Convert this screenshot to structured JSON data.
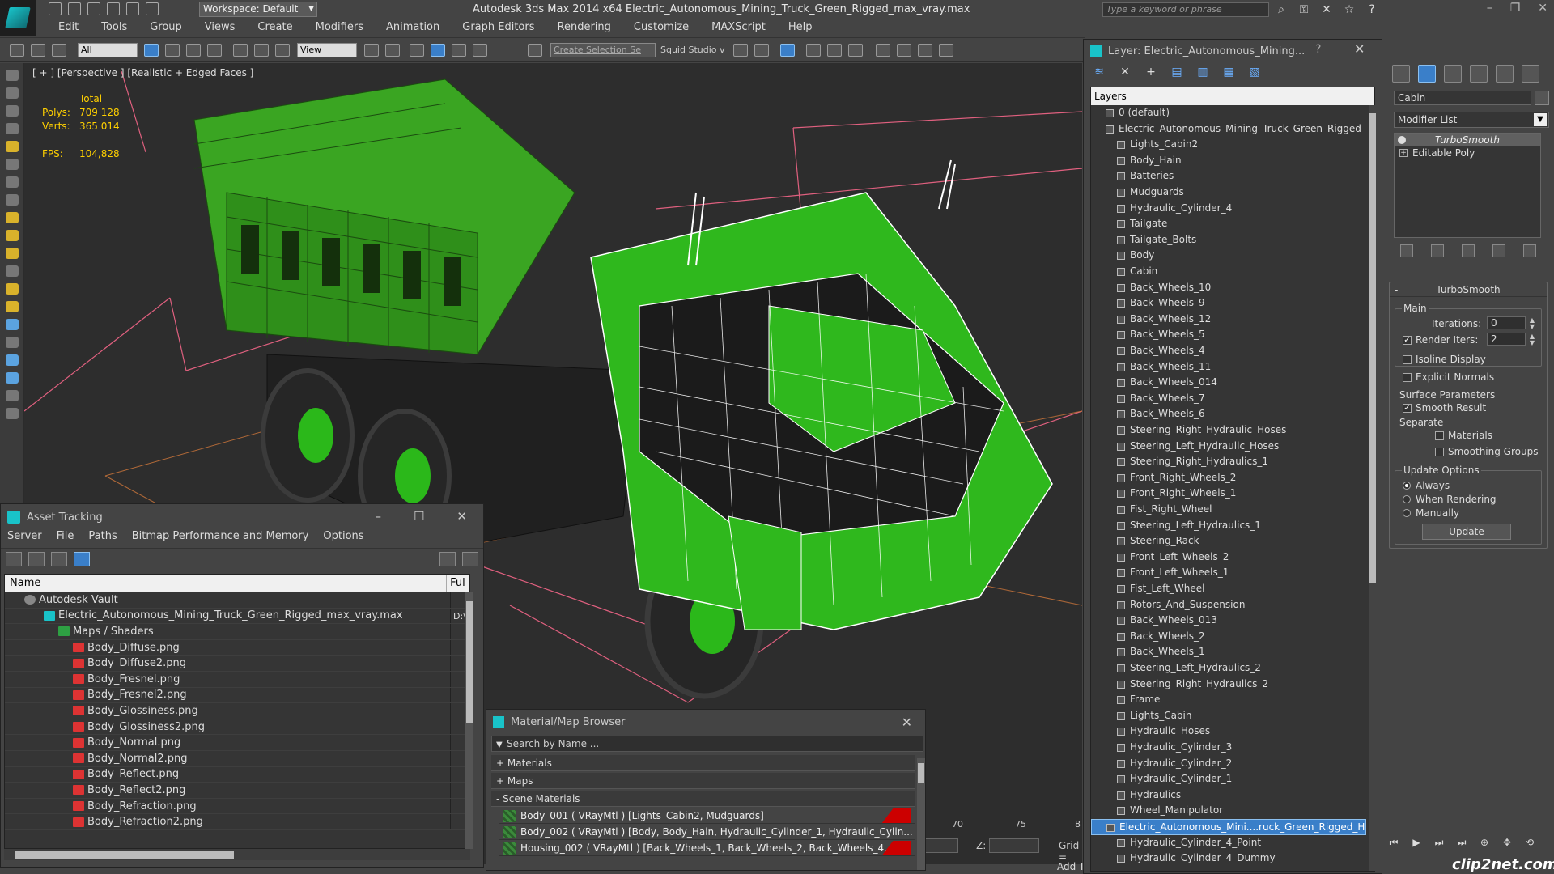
{
  "titlebar": {
    "workspace": "Workspace: Default",
    "title": "Autodesk 3ds Max  2014 x64      Electric_Autonomous_Mining_Truck_Green_Rigged_max_vray.max",
    "search_placeholder": "Type a keyword or phrase"
  },
  "menubar": [
    "Edit",
    "Tools",
    "Group",
    "Views",
    "Create",
    "Modifiers",
    "Animation",
    "Graph Editors",
    "Rendering",
    "Customize",
    "MAXScript",
    "Help"
  ],
  "toolbar": {
    "selection_filter": "All",
    "reference_coord": "View",
    "selection_set": "Create Selection Se",
    "squid": "Squid Studio v"
  },
  "viewport": {
    "label": "[ + ] [Perspective ] [Realistic + Edged Faces ]",
    "stats_header": "Total",
    "polys_label": "Polys:",
    "polys": "709 128",
    "verts_label": "Verts:",
    "verts": "365 014",
    "fps_label": "FPS:",
    "fps": "104,828"
  },
  "timeline": {
    "t1": "70",
    "t2": "75",
    "t3": "8"
  },
  "coords": {
    "z_label": "Z:",
    "grid_label": "Grid =",
    "add_label": "Add T"
  },
  "asset_tracking": {
    "title": "Asset Tracking",
    "menu": [
      "Server",
      "File",
      "Paths",
      "Bitmap Performance and Memory",
      "Options"
    ],
    "col_name": "Name",
    "col_full": "Ful",
    "rows": [
      {
        "label": "Autodesk Vault",
        "type": "vault",
        "indent": 24,
        "full": ""
      },
      {
        "label": "Electric_Autonomous_Mining_Truck_Green_Rigged_max_vray.max",
        "type": "max",
        "indent": 48,
        "full": "D:\\"
      },
      {
        "label": "Maps / Shaders",
        "type": "fold",
        "indent": 66,
        "full": ""
      },
      {
        "label": "Body_Diffuse.png",
        "type": "png",
        "indent": 84,
        "full": ""
      },
      {
        "label": "Body_Diffuse2.png",
        "type": "png",
        "indent": 84,
        "full": ""
      },
      {
        "label": "Body_Fresnel.png",
        "type": "png",
        "indent": 84,
        "full": ""
      },
      {
        "label": "Body_Fresnel2.png",
        "type": "png",
        "indent": 84,
        "full": ""
      },
      {
        "label": "Body_Glossiness.png",
        "type": "png",
        "indent": 84,
        "full": ""
      },
      {
        "label": "Body_Glossiness2.png",
        "type": "png",
        "indent": 84,
        "full": ""
      },
      {
        "label": "Body_Normal.png",
        "type": "png",
        "indent": 84,
        "full": ""
      },
      {
        "label": "Body_Normal2.png",
        "type": "png",
        "indent": 84,
        "full": ""
      },
      {
        "label": "Body_Reflect.png",
        "type": "png",
        "indent": 84,
        "full": ""
      },
      {
        "label": "Body_Reflect2.png",
        "type": "png",
        "indent": 84,
        "full": ""
      },
      {
        "label": "Body_Refraction.png",
        "type": "png",
        "indent": 84,
        "full": ""
      },
      {
        "label": "Body_Refraction2.png",
        "type": "png",
        "indent": 84,
        "full": ""
      }
    ]
  },
  "material_browser": {
    "title": "Material/Map Browser",
    "search_placeholder": "Search by Name ...",
    "sections": [
      "+ Materials",
      "+ Maps",
      "- Scene Materials"
    ],
    "materials": [
      {
        "label": "Body_001  ( VRayMtl )  [Lights_Cabin2, Mudguards]",
        "red": true
      },
      {
        "label": "Body_002  ( VRayMtl )  [Body, Body_Hain, Hydraulic_Cylinder_1, Hydraulic_Cylin...",
        "red": false
      },
      {
        "label": "Housing_002  ( VRayMtl )  [Back_Wheels_1, Back_Wheels_2, Back_Wheels_4, Ba...",
        "red": true
      }
    ]
  },
  "layer_explorer": {
    "title": "Layer: Electric_Autonomous_Mining...",
    "help": "?",
    "header": "Layers",
    "rows": [
      {
        "label": "0 (default)",
        "level": 1,
        "sel": false
      },
      {
        "label": "Electric_Autonomous_Mining_Truck_Green_Rigged",
        "level": 1,
        "sel": false
      },
      {
        "label": "Lights_Cabin2",
        "level": 2,
        "sel": false
      },
      {
        "label": "Body_Hain",
        "level": 2,
        "sel": false
      },
      {
        "label": "Batteries",
        "level": 2,
        "sel": false
      },
      {
        "label": "Mudguards",
        "level": 2,
        "sel": false
      },
      {
        "label": "Hydraulic_Cylinder_4",
        "level": 2,
        "sel": false
      },
      {
        "label": "Tailgate",
        "level": 2,
        "sel": false
      },
      {
        "label": "Tailgate_Bolts",
        "level": 2,
        "sel": false
      },
      {
        "label": "Body",
        "level": 2,
        "sel": false
      },
      {
        "label": "Cabin",
        "level": 2,
        "sel": false
      },
      {
        "label": "Back_Wheels_10",
        "level": 2,
        "sel": false
      },
      {
        "label": "Back_Wheels_9",
        "level": 2,
        "sel": false
      },
      {
        "label": "Back_Wheels_12",
        "level": 2,
        "sel": false
      },
      {
        "label": "Back_Wheels_5",
        "level": 2,
        "sel": false
      },
      {
        "label": "Back_Wheels_4",
        "level": 2,
        "sel": false
      },
      {
        "label": "Back_Wheels_11",
        "level": 2,
        "sel": false
      },
      {
        "label": "Back_Wheels_014",
        "level": 2,
        "sel": false
      },
      {
        "label": "Back_Wheels_7",
        "level": 2,
        "sel": false
      },
      {
        "label": "Back_Wheels_6",
        "level": 2,
        "sel": false
      },
      {
        "label": "Steering_Right_Hydraulic_Hoses",
        "level": 2,
        "sel": false
      },
      {
        "label": "Steering_Left_Hydraulic_Hoses",
        "level": 2,
        "sel": false
      },
      {
        "label": "Steering_Right_Hydraulics_1",
        "level": 2,
        "sel": false
      },
      {
        "label": "Front_Right_Wheels_2",
        "level": 2,
        "sel": false
      },
      {
        "label": "Front_Right_Wheels_1",
        "level": 2,
        "sel": false
      },
      {
        "label": "Fist_Right_Wheel",
        "level": 2,
        "sel": false
      },
      {
        "label": "Steering_Left_Hydraulics_1",
        "level": 2,
        "sel": false
      },
      {
        "label": "Steering_Rack",
        "level": 2,
        "sel": false
      },
      {
        "label": "Front_Left_Wheels_2",
        "level": 2,
        "sel": false
      },
      {
        "label": "Front_Left_Wheels_1",
        "level": 2,
        "sel": false
      },
      {
        "label": "Fist_Left_Wheel",
        "level": 2,
        "sel": false
      },
      {
        "label": "Rotors_And_Suspension",
        "level": 2,
        "sel": false
      },
      {
        "label": "Back_Wheels_013",
        "level": 2,
        "sel": false
      },
      {
        "label": "Back_Wheels_2",
        "level": 2,
        "sel": false
      },
      {
        "label": "Back_Wheels_1",
        "level": 2,
        "sel": false
      },
      {
        "label": "Steering_Left_Hydraulics_2",
        "level": 2,
        "sel": false
      },
      {
        "label": "Steering_Right_Hydraulics_2",
        "level": 2,
        "sel": false
      },
      {
        "label": "Frame",
        "level": 2,
        "sel": false
      },
      {
        "label": "Lights_Cabin",
        "level": 2,
        "sel": false
      },
      {
        "label": "Hydraulic_Hoses",
        "level": 2,
        "sel": false
      },
      {
        "label": "Hydraulic_Cylinder_3",
        "level": 2,
        "sel": false
      },
      {
        "label": "Hydraulic_Cylinder_2",
        "level": 2,
        "sel": false
      },
      {
        "label": "Hydraulic_Cylinder_1",
        "level": 2,
        "sel": false
      },
      {
        "label": "Hydraulics",
        "level": 2,
        "sel": false
      },
      {
        "label": "Wheel_Manipulator",
        "level": 2,
        "sel": false
      },
      {
        "label": "Electric_Autonomous_Mini....ruck_Green_Rigged_H",
        "level": 1,
        "sel": true
      },
      {
        "label": "Hydraulic_Cylinder_4_Point",
        "level": 2,
        "sel": false
      },
      {
        "label": "Hydraulic_Cylinder_4_Dummy",
        "level": 2,
        "sel": false
      }
    ]
  },
  "command_panel": {
    "object_name": "Cabin",
    "modifier_list": "Modifier List",
    "stack": [
      "TurboSmooth",
      "Editable Poly"
    ],
    "rollout_title": "TurboSmooth",
    "main_label": "Main",
    "iterations_label": "Iterations:",
    "iterations": "0",
    "render_iters_label": "Render Iters:",
    "render_iters": "2",
    "isoline": "Isoline Display",
    "explicit": "Explicit Normals",
    "surface_label": "Surface Parameters",
    "smooth_result": "Smooth Result",
    "separate_label": "Separate",
    "materials": "Materials",
    "smoothing_groups": "Smoothing Groups",
    "update_options": "Update Options",
    "always": "Always",
    "when_rendering": "When Rendering",
    "manually": "Manually",
    "update_btn": "Update"
  },
  "watermark": "clip2net.com"
}
